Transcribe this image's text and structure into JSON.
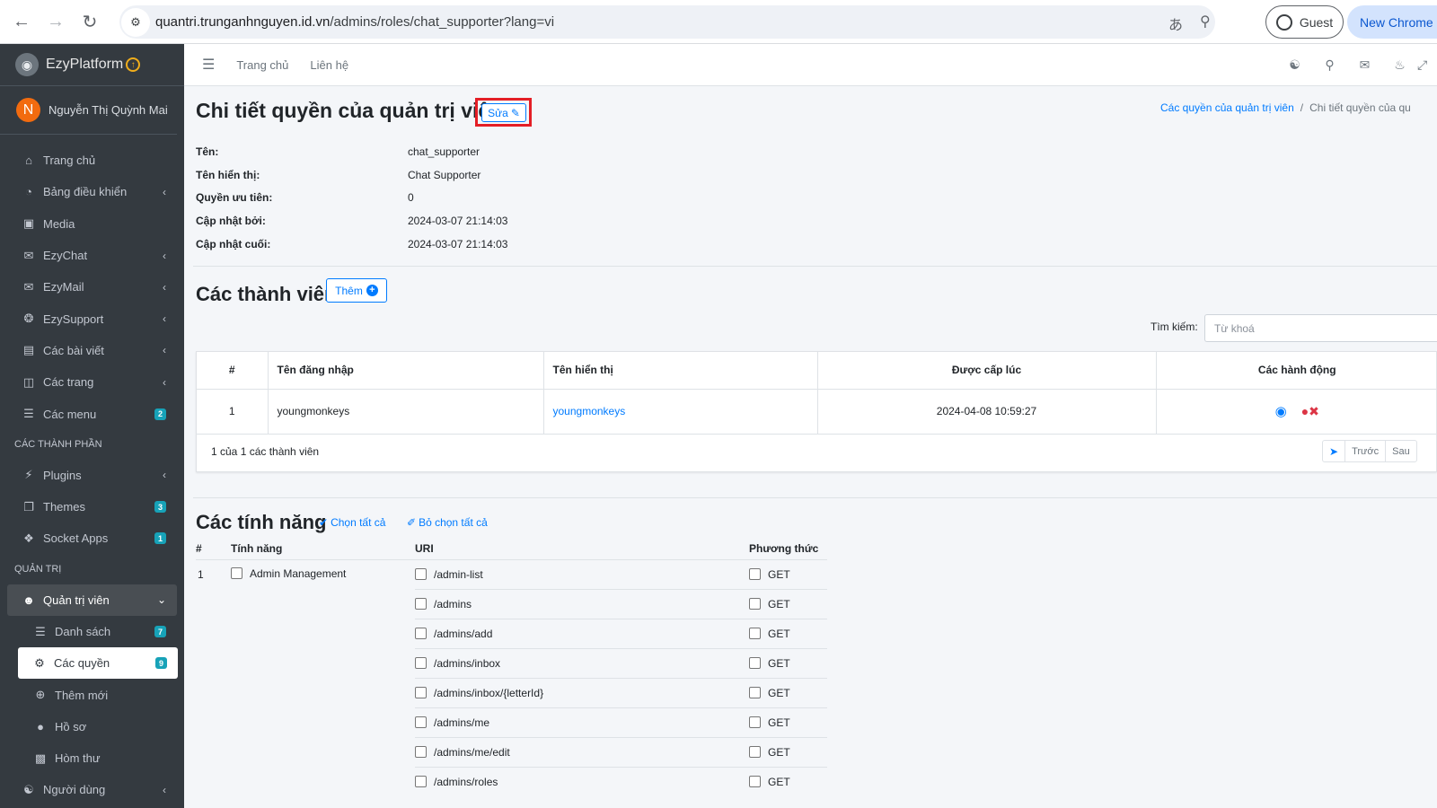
{
  "browser": {
    "url_host": "quantri.trunganhnguyen.id.vn",
    "url_path": "/admins/roles/chat_supporter?lang=vi",
    "guest_label": "Guest",
    "new_chrome_label": "New Chrome a"
  },
  "sidebar": {
    "brand": "EzyPlatform",
    "user_initial": "N",
    "user_name": "Nguyễn Thị Quỳnh Mai",
    "items": [
      {
        "label": "Trang chủ",
        "icon": "home-icon"
      },
      {
        "label": "Bảng điều khiển",
        "icon": "dashboard-icon",
        "chevron": true
      },
      {
        "label": "Media",
        "icon": "image-icon"
      },
      {
        "label": "EzyChat",
        "icon": "chat-icon",
        "chevron": true
      },
      {
        "label": "EzyMail",
        "icon": "mail-icon",
        "chevron": true
      },
      {
        "label": "EzySupport",
        "icon": "support-icon",
        "chevron": true
      },
      {
        "label": "Các bài viết",
        "icon": "posts-icon",
        "chevron": true
      },
      {
        "label": "Các trang",
        "icon": "pages-icon",
        "chevron": true
      },
      {
        "label": "Các menu",
        "icon": "menu-icon",
        "badge": "2"
      }
    ],
    "header_components": "CÁC THÀNH PHẦN",
    "component_items": [
      {
        "label": "Plugins",
        "icon": "plug-icon",
        "chevron": true
      },
      {
        "label": "Themes",
        "icon": "themes-icon",
        "badge": "3"
      },
      {
        "label": "Socket Apps",
        "icon": "apps-icon",
        "badge": "1"
      }
    ],
    "header_admin": "QUẢN TRỊ",
    "admin_parent": {
      "label": "Quản trị viên",
      "icon": "user-circle-icon"
    },
    "admin_sub": [
      {
        "label": "Danh sách",
        "icon": "list-icon",
        "badge": "7"
      },
      {
        "label": "Các quyền",
        "icon": "users-cog-icon",
        "badge": "9",
        "active": true
      },
      {
        "label": "Thêm mới",
        "icon": "plus-circle-icon"
      },
      {
        "label": "Hồ sơ",
        "icon": "user-icon"
      },
      {
        "label": "Hòm thư",
        "icon": "inbox-icon"
      }
    ],
    "users_item": {
      "label": "Người dùng",
      "icon": "users-icon",
      "chevron": true
    }
  },
  "topnav": {
    "home": "Trang chủ",
    "contact": "Liên hệ"
  },
  "page": {
    "title": "Chi tiết quyền của quản trị viên",
    "edit_label": "Sửa",
    "breadcrumb_link": "Các quyền của quản trị viên",
    "breadcrumb_current": "Chi tiết quyền của qu",
    "details": [
      {
        "key": "Tên:",
        "value": "chat_supporter"
      },
      {
        "key": "Tên hiển thị:",
        "value": "Chat Supporter"
      },
      {
        "key": "Quyền ưu tiên:",
        "value": "0"
      },
      {
        "key": "Cập nhật bởi:",
        "value": "2024-03-07 21:14:03"
      },
      {
        "key": "Cập nhật cuối:",
        "value": "2024-03-07 21:14:03"
      }
    ]
  },
  "members": {
    "title": "Các thành viên",
    "add_label": "Thêm",
    "search_label": "Tìm kiếm:",
    "search_placeholder": "Từ khoá",
    "columns": [
      "#",
      "Tên đăng nhập",
      "Tên hiển thị",
      "Được cấp lúc",
      "Các hành động"
    ],
    "rows": [
      {
        "index": "1",
        "username": "youngmonkeys",
        "display_name": "youngmonkeys",
        "granted_at": "2024-04-08 10:59:27"
      }
    ],
    "count_text": "1 của 1 các thành viên",
    "pager_prev": "Trước",
    "pager_next": "Sau"
  },
  "features": {
    "title": "Các tính năng",
    "select_all": "Chọn tất cả",
    "deselect_all": "Bỏ chọn tất cả",
    "columns": [
      "#",
      "Tính năng",
      "URI",
      "Phương thức"
    ],
    "feature_index": "1",
    "feature_name": "Admin Management",
    "uris": [
      {
        "uri": "/admin-list",
        "method": "GET"
      },
      {
        "uri": "/admins",
        "method": "GET"
      },
      {
        "uri": "/admins/add",
        "method": "GET"
      },
      {
        "uri": "/admins/inbox",
        "method": "GET"
      },
      {
        "uri": "/admins/inbox/{letterId}",
        "method": "GET"
      },
      {
        "uri": "/admins/me",
        "method": "GET"
      },
      {
        "uri": "/admins/me/edit",
        "method": "GET"
      },
      {
        "uri": "/admins/roles",
        "method": "GET"
      }
    ]
  }
}
